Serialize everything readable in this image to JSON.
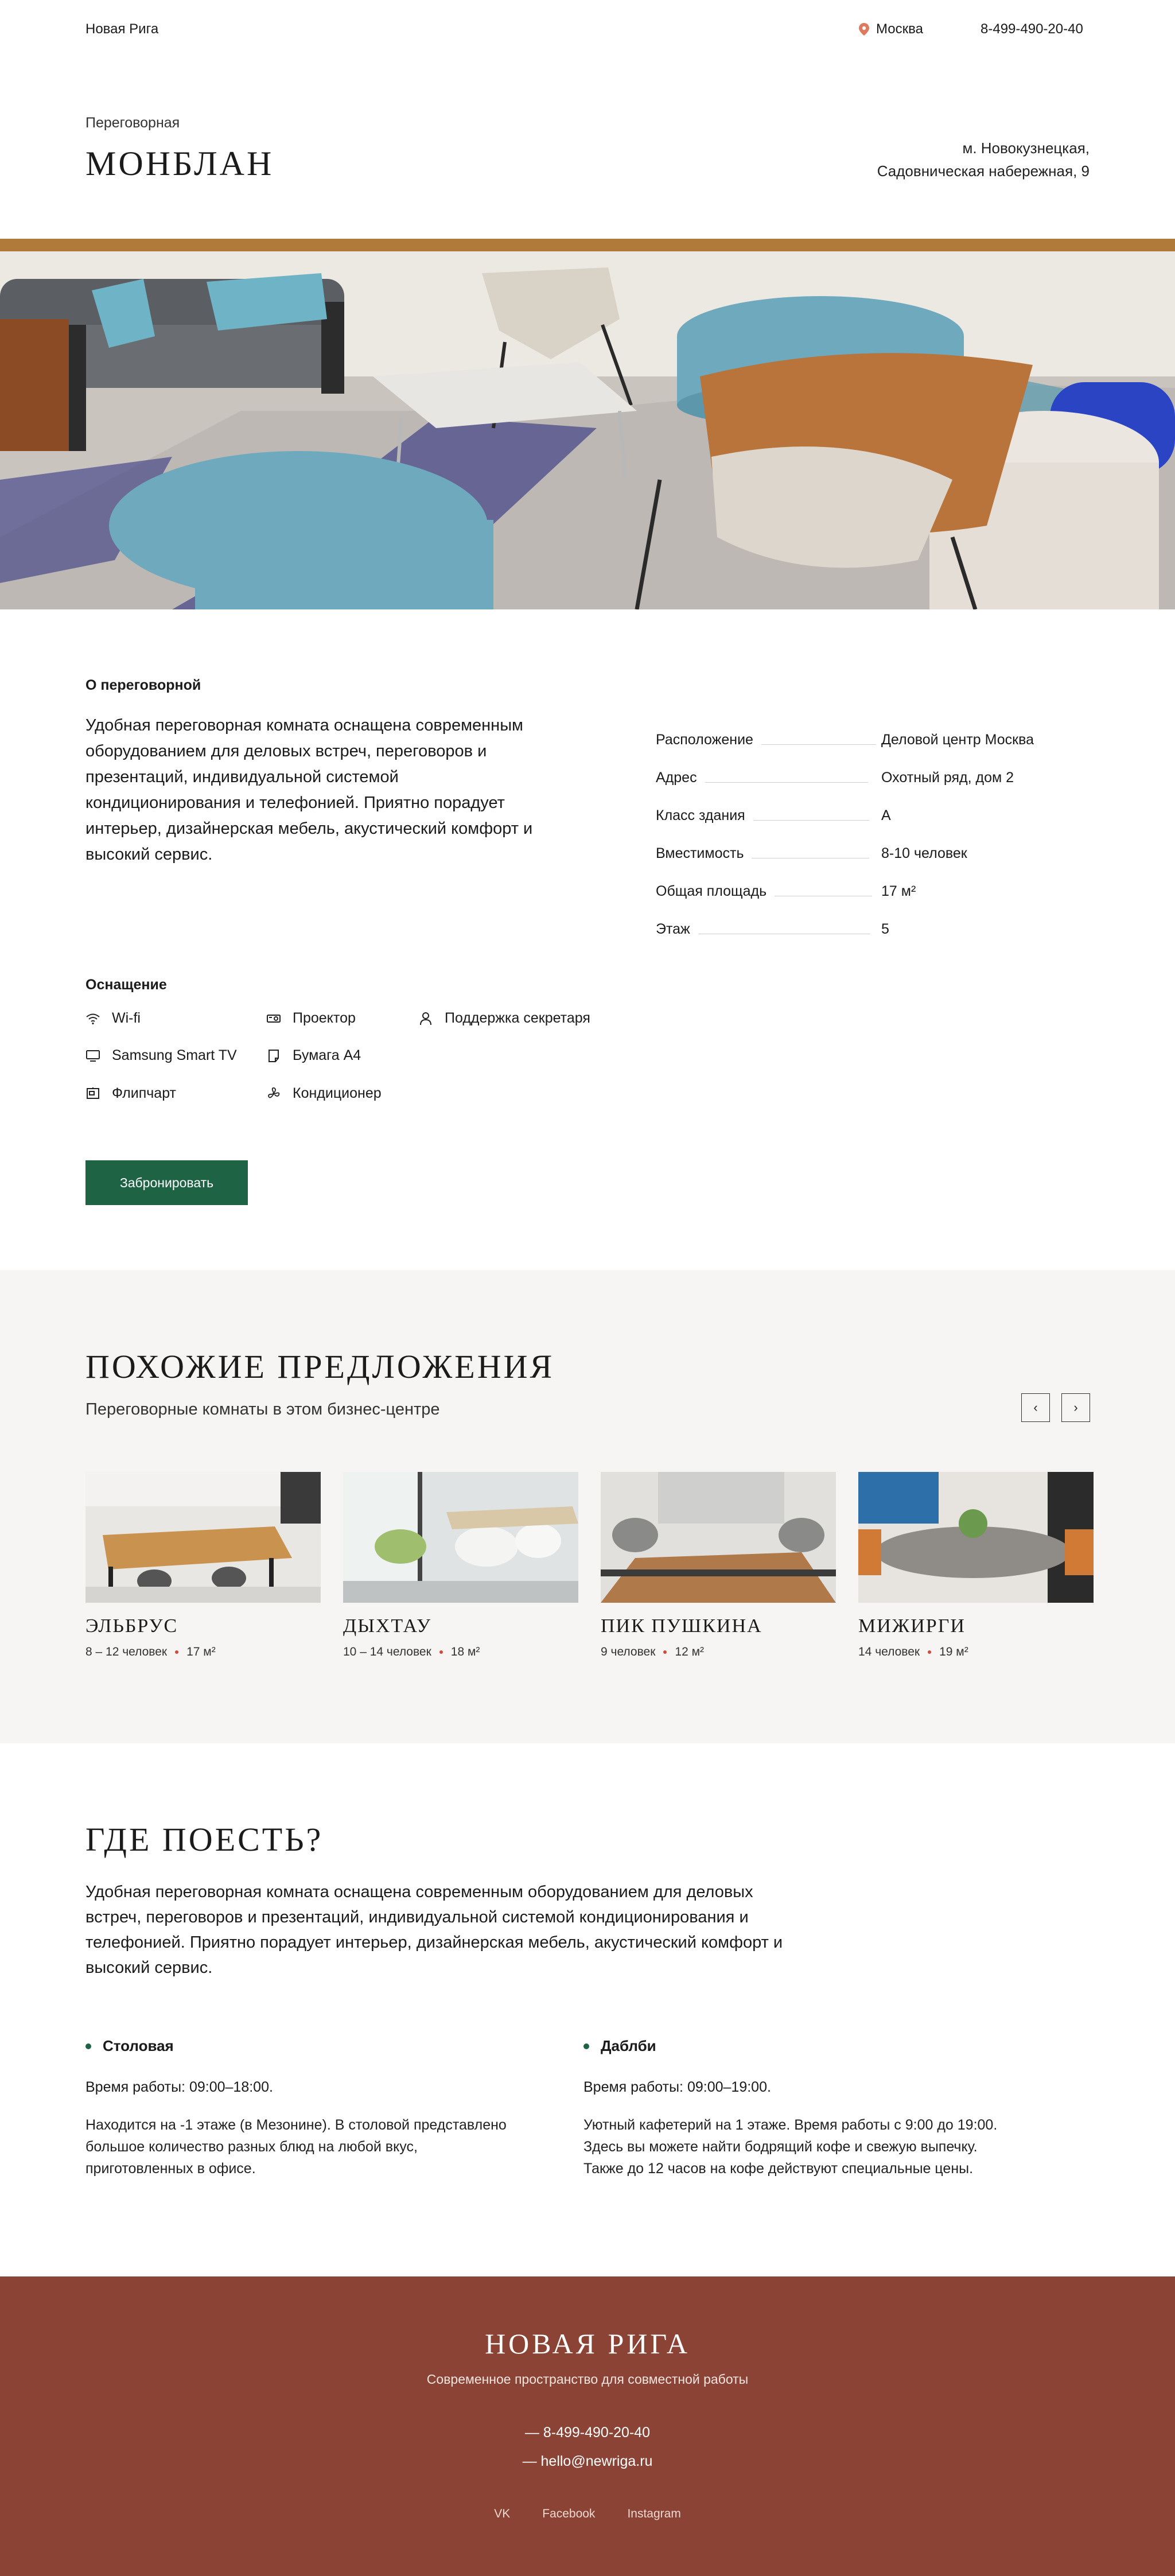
{
  "header": {
    "brand": "Новая Рига",
    "city": "Москва",
    "phone": "8-499-490-20-40"
  },
  "room": {
    "kicker": "Переговорная",
    "title": "МОНБЛАН",
    "address_line1": "м. Новокузнецкая,",
    "address_line2": "Садовническая набережная, 9"
  },
  "about": {
    "heading": "О переговорной",
    "text": "Удобная переговорная комната оснащена современным оборудованием для деловых встреч, переговоров и презентаций, индивидуальной системой кондиционирования и телефонией. Приятно порадует интерьер, дизайнерская мебель, акустический комфорт и высокий сервис.",
    "facts": [
      {
        "label": "Расположение",
        "value": "Деловой центр Москва"
      },
      {
        "label": "Адрес",
        "value": "Охотный ряд, дом 2"
      },
      {
        "label": "Класс здания",
        "value": "А"
      },
      {
        "label": "Вместимость",
        "value": "8-10 человек"
      },
      {
        "label": "Общая площадь",
        "value": "17 м²"
      },
      {
        "label": "Этаж",
        "value": "5"
      }
    ]
  },
  "equipment": {
    "heading": "Оснащение",
    "items": [
      {
        "label": "Wi-fi",
        "icon": "wifi-icon"
      },
      {
        "label": "Samsung Smart TV",
        "icon": "tv-icon"
      },
      {
        "label": "Флипчарт",
        "icon": "flipchart-icon"
      },
      {
        "label": "Проектор",
        "icon": "projector-icon"
      },
      {
        "label": "Бумага А4",
        "icon": "paper-icon"
      },
      {
        "label": "Кондиционер",
        "icon": "fan-icon"
      },
      {
        "label": "Поддержка секретаря",
        "icon": "person-icon"
      }
    ]
  },
  "book_button": "Забронировать",
  "similar": {
    "title": "ПОХОЖИЕ ПРЕДЛОЖЕНИЯ",
    "subtitle": "Переговорные комнаты в этом бизнес-центре",
    "prev_icon": "‹",
    "next_icon": "›",
    "cards": [
      {
        "name": "ЭЛЬБРУС",
        "capacity": "8 – 12 человек",
        "area": "17 м²"
      },
      {
        "name": "ДЫХТАУ",
        "capacity": "10 – 14 человек",
        "area": "18 м²"
      },
      {
        "name": "ПИК ПУШКИНА",
        "capacity": "9 человек",
        "area": "12 м²"
      },
      {
        "name": "МИЖИРГИ",
        "capacity": "14 человек",
        "area": "19 м²"
      }
    ]
  },
  "eat": {
    "title": "ГДЕ ПОЕСТЬ?",
    "text": "Удобная переговорная комната оснащена современным оборудованием для деловых встреч, переговоров и презентаций, индивидуальной системой кондиционирования и телефонией. Приятно порадует интерьер, дизайнерская мебель, акустический комфорт и высокий сервис.",
    "places": [
      {
        "name": "Столовая",
        "hours": "Время работы: 09:00–18:00.",
        "desc": "Находится на -1 этаже (в Мезонине). В столовой представлено большое количество разных блюд на любой вкус, приготовленных в офисе."
      },
      {
        "name": "Даблби",
        "hours": "Время работы: 09:00–19:00.",
        "desc": "Уютный кафетерий на 1 этаже. Время работы с 9:00 до 19:00. Здесь вы можете найти бодрящий кофе и свежую выпечку. Также до 12 часов на кофе действуют специальные цены."
      }
    ]
  },
  "footer": {
    "title": "НОВАЯ РИГА",
    "subtitle": "Современное пространство для совместной работы",
    "phone": "— 8-499-490-20-40",
    "email": "— hello@newriga.ru",
    "links": [
      "VK",
      "Facebook",
      "Instagram"
    ]
  }
}
